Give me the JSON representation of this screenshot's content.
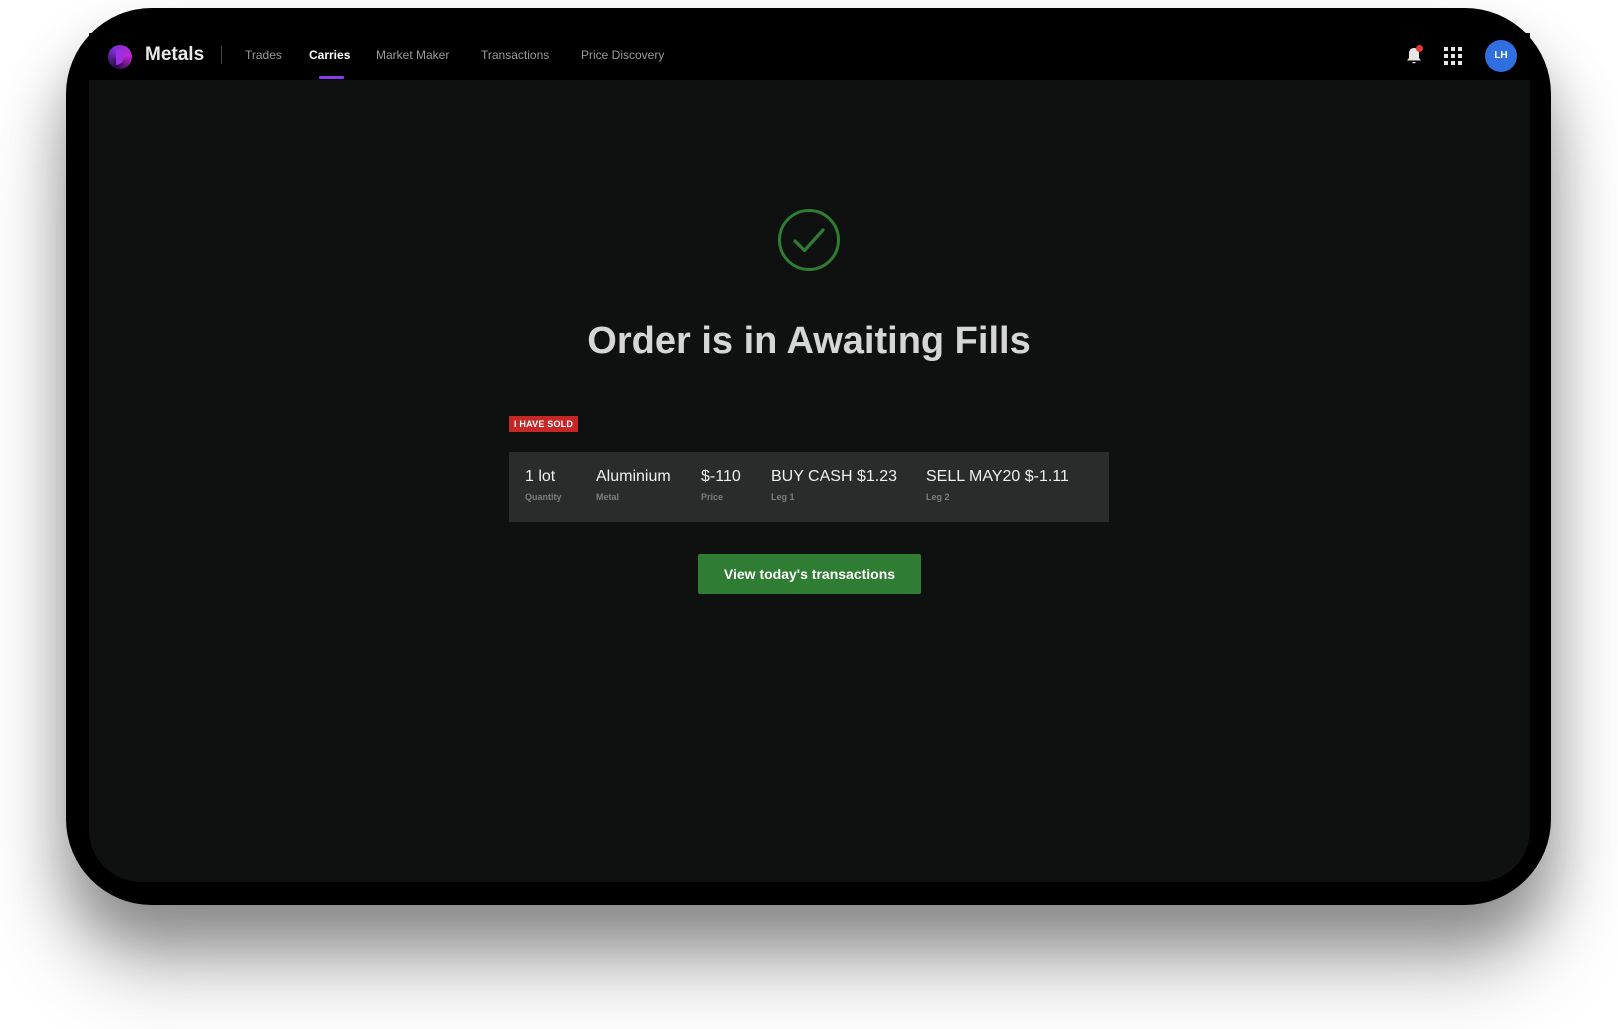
{
  "app": {
    "brand": "Metals"
  },
  "nav": {
    "items": [
      {
        "label": "Trades",
        "active": false
      },
      {
        "label": "Carries",
        "active": true
      },
      {
        "label": "Market Maker",
        "active": false
      },
      {
        "label": "Transactions",
        "active": false
      },
      {
        "label": "Price Discovery",
        "active": false
      }
    ]
  },
  "header": {
    "notifications_icon": "bell-icon",
    "apps_icon": "grid-icon",
    "avatar_initials": "LH"
  },
  "main": {
    "status_icon": "check-circle-icon",
    "title": "Order is in Awaiting Fills",
    "badge": "I HAVE SOLD",
    "order": {
      "fields": [
        {
          "value": "1 lot",
          "label": "Quantity"
        },
        {
          "value": "Aluminium",
          "label": "Metal"
        },
        {
          "value": "$-110",
          "label": "Price"
        },
        {
          "value": "BUY CASH $1.23",
          "label": "Leg 1"
        },
        {
          "value": "SELL MAY20 $-1.11",
          "label": "Leg 2"
        }
      ]
    },
    "cta_label": "View today's transactions"
  },
  "colors": {
    "accent": "#8a3ce6",
    "success": "#2e7d32",
    "badge": "#c62828",
    "avatar": "#2f6fe0"
  }
}
